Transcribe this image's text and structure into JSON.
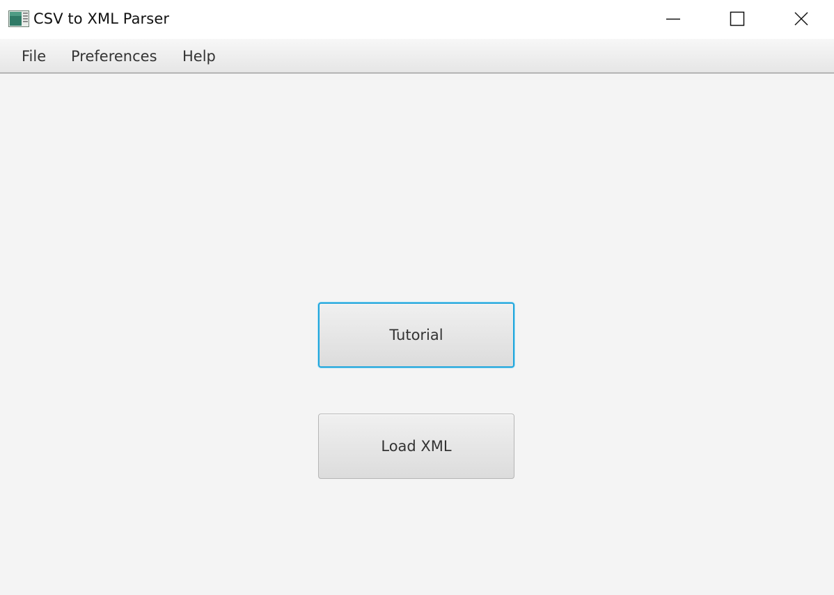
{
  "window": {
    "title": "CSV to XML Parser",
    "app_icon": "spreadsheet-app-icon",
    "controls": {
      "minimize_icon": "minimize-icon",
      "maximize_icon": "maximize-icon",
      "close_icon": "close-icon"
    }
  },
  "menubar": {
    "items": [
      {
        "label": "File"
      },
      {
        "label": "Preferences"
      },
      {
        "label": "Help"
      }
    ]
  },
  "main": {
    "tutorial_label": "Tutorial",
    "load_xml_label": "Load XML"
  },
  "colors": {
    "focus_border": "#1ea5dc",
    "background": "#f4f4f4"
  }
}
